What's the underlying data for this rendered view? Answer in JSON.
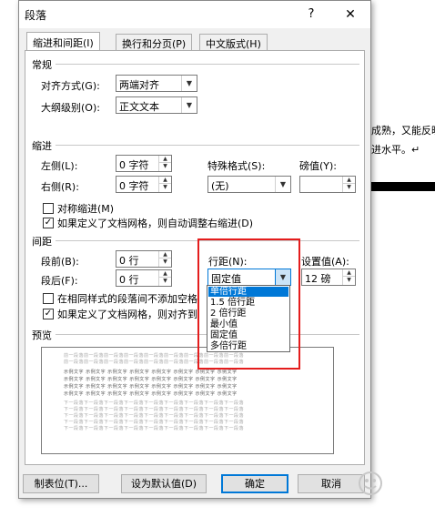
{
  "background_doc": {
    "line1": "成熟，又能反映",
    "line2": "进水平。↵"
  },
  "dialog": {
    "title": "段落",
    "help": "?",
    "close": "✕"
  },
  "tabs": [
    {
      "label": "缩进和间距(I)",
      "active": true
    },
    {
      "label": "换行和分页(P)",
      "active": false
    },
    {
      "label": "中文版式(H)",
      "active": false
    }
  ],
  "general": {
    "title": "常规",
    "alignment_label": "对齐方式(G):",
    "alignment_value": "两端对齐",
    "outline_label": "大纲级别(O):",
    "outline_value": "正文文本"
  },
  "indent": {
    "title": "缩进",
    "left_label": "左侧(L):",
    "left_value": "0 字符",
    "right_label": "右侧(R):",
    "right_value": "0 字符",
    "special_label": "特殊格式(S):",
    "special_value": "(无)",
    "by_label": "磅值(Y):",
    "by_value": "",
    "mirror_label": "对称缩进(M)",
    "mirror_checked": false,
    "auto_adjust_label": "如果定义了文档网格，则自动调整右缩进(D)",
    "auto_adjust_checked": true
  },
  "spacing": {
    "title": "间距",
    "before_label": "段前(B):",
    "before_value": "0 行",
    "after_label": "段后(F):",
    "after_value": "0 行",
    "line_spacing_label": "行距(N):",
    "line_spacing_value": "固定值",
    "at_label": "设置值(A):",
    "at_value": "12 磅",
    "no_space_label": "在相同样式的段落间不添加空格",
    "no_space_checked": false,
    "snap_grid_label": "如果定义了文档网格，则对齐到",
    "snap_grid_checked": true
  },
  "line_spacing_options": [
    {
      "label": "单倍行距",
      "selected": true
    },
    {
      "label": "1.5 倍行距",
      "selected": false
    },
    {
      "label": "2 倍行距",
      "selected": false
    },
    {
      "label": "最小值",
      "selected": false
    },
    {
      "label": "固定值",
      "selected": false
    },
    {
      "label": "多倍行距",
      "selected": false
    }
  ],
  "preview": {
    "title": "预览",
    "prev_text": "前一段落前一段落前一段落前一段落前一段落前一段落前一段落前一段落前一段落",
    "sample_text": "示例文字 示例文字 示例文字 示例文字 示例文字 示例文字 示例文字 示例文字",
    "next_text": "下一段落下一段落下一段落下一段落下一段落下一段落下一段落下一段落下一段落"
  },
  "buttons": {
    "tabs": "制表位(T)...",
    "set_default": "设为默认值(D)",
    "ok": "确定",
    "cancel": "取消"
  },
  "colors": {
    "accent": "#0078d7",
    "highlight_box": "#e41d1d"
  }
}
